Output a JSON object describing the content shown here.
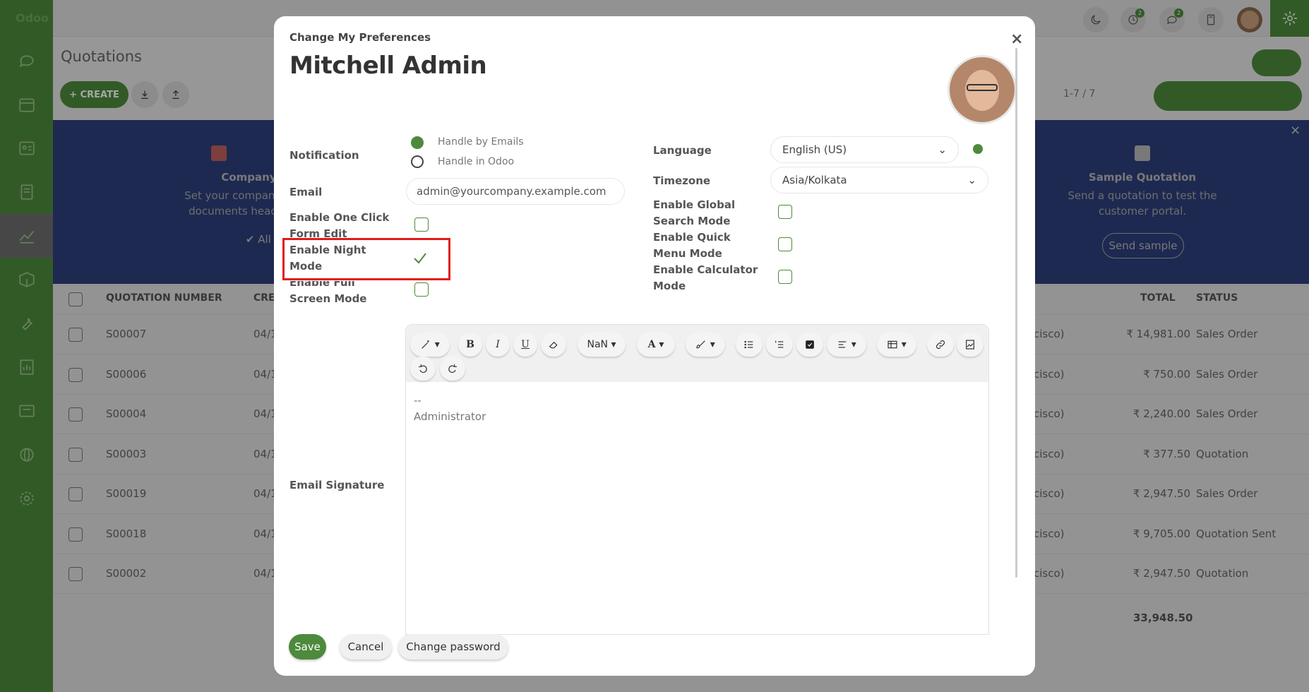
{
  "app": {
    "logo": "Odoo",
    "page_title": "Quotations",
    "create_label": "CREATE",
    "pager": "1-7 / 7",
    "top_badges": [
      "2",
      "2"
    ]
  },
  "banner": {
    "left_title": "Company Data",
    "left_desc_1": "Set your company's data",
    "left_desc_2": "documents header/foot",
    "left_done": "All done!",
    "right_title": "Sample Quotation",
    "right_desc_1": "Send a quotation to test the",
    "right_desc_2": "customer portal.",
    "right_btn": "Send sample"
  },
  "table": {
    "headers": {
      "number": "QUOTATION NUMBER",
      "created": "CREA",
      "total": "TOTAL",
      "status": "STATUS"
    },
    "rows": [
      {
        "number": "S00007",
        "date": "04/1",
        "customer": "cisco)",
        "total": "₹ 14,981.00",
        "status": "Sales Order"
      },
      {
        "number": "S00006",
        "date": "04/1",
        "customer": "cisco)",
        "total": "₹ 750.00",
        "status": "Sales Order"
      },
      {
        "number": "S00004",
        "date": "04/1",
        "customer": "cisco)",
        "total": "₹ 2,240.00",
        "status": "Sales Order"
      },
      {
        "number": "S00003",
        "date": "04/1",
        "customer": "cisco)",
        "total": "₹ 377.50",
        "status": "Quotation"
      },
      {
        "number": "S00019",
        "date": "04/1",
        "customer": "cisco)",
        "total": "₹ 2,947.50",
        "status": "Sales Order"
      },
      {
        "number": "S00018",
        "date": "04/1",
        "customer": "cisco)",
        "total": "₹ 9,705.00",
        "status": "Quotation Sent"
      },
      {
        "number": "S00002",
        "date": "04/1",
        "customer": "cisco)",
        "total": "₹ 2,947.50",
        "status": "Quotation"
      }
    ],
    "grand_total": "33,948.50"
  },
  "modal": {
    "subtitle": "Change My Preferences",
    "user_name": "Mitchell Admin",
    "close_label": "×",
    "notification": {
      "label": "Notification",
      "option_email": "Handle by Emails",
      "option_odoo": "Handle in Odoo"
    },
    "email": {
      "label": "Email",
      "value": "admin@yourcompany.example.com"
    },
    "one_click": {
      "label_1": "Enable One Click",
      "label_2": "Form Edit"
    },
    "night_mode": {
      "label_1": "Enable Night",
      "label_2": "Mode"
    },
    "full_screen": {
      "label_1": "Enable Full",
      "label_2": "Screen Mode"
    },
    "language": {
      "label": "Language",
      "value": "English (US)"
    },
    "timezone": {
      "label": "Timezone",
      "value": "Asia/Kolkata"
    },
    "global_search": {
      "label_1": "Enable Global",
      "label_2": "Search Mode"
    },
    "quick_menu": {
      "label_1": "Enable Quick",
      "label_2": "Menu Mode"
    },
    "calculator": {
      "label_1": "Enable Calculator",
      "label_2": "Mode"
    },
    "signature": {
      "label": "Email Signature",
      "line_1": "--",
      "line_2": "Administrator",
      "font_size": "NaN"
    },
    "buttons": {
      "save": "Save",
      "cancel": "Cancel",
      "change_password": "Change password"
    }
  },
  "colors": {
    "brand": "#4d8a3c",
    "highlight": "#e01b1b",
    "banner": "#2e3f7d"
  }
}
